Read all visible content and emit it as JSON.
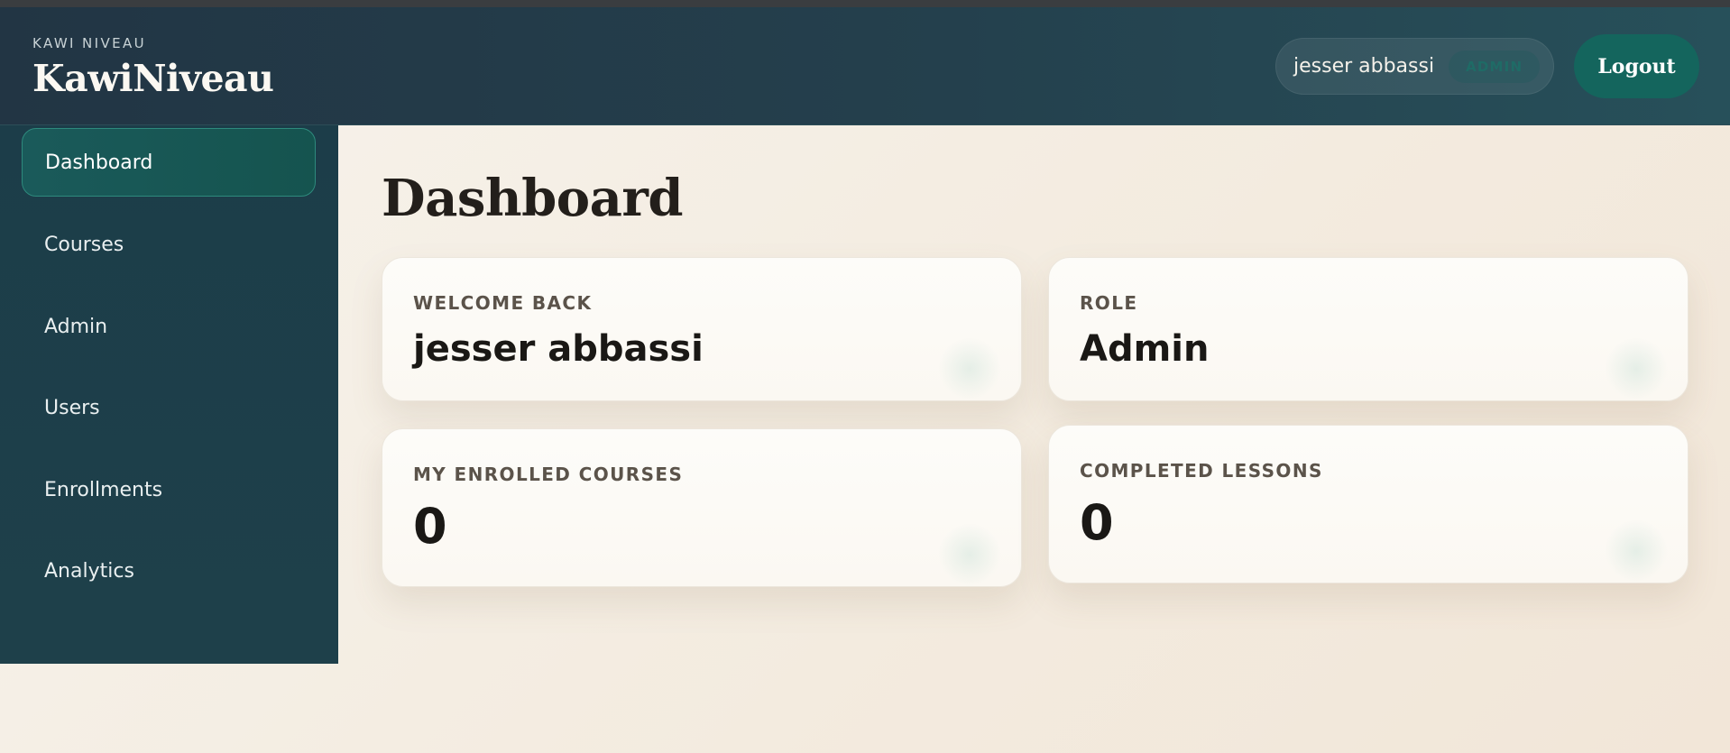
{
  "brand": {
    "kicker": "KAWI NIVEAU",
    "title": "KawiNiveau"
  },
  "user": {
    "name": "jesser abbassi",
    "role_badge": "ADMIN"
  },
  "header": {
    "logout_label": "Logout"
  },
  "sidebar": {
    "items": [
      {
        "label": "Dashboard",
        "active": true
      },
      {
        "label": "Courses",
        "active": false
      },
      {
        "label": "Admin",
        "active": false
      },
      {
        "label": "Users",
        "active": false
      },
      {
        "label": "Enrollments",
        "active": false
      },
      {
        "label": "Analytics",
        "active": false
      }
    ]
  },
  "main": {
    "title": "Dashboard",
    "cards": [
      {
        "label": "WELCOME BACK",
        "value": "jesser abbassi"
      },
      {
        "label": "ROLE",
        "value": "Admin"
      },
      {
        "label": "MY ENROLLED COURSES",
        "value": "0"
      },
      {
        "label": "COMPLETED LESSONS",
        "value": "0"
      }
    ]
  },
  "colors": {
    "header_bg": "#223544",
    "sidebar_bg": "#1c3d49",
    "accent": "#14655d",
    "page_bg": "#f5efe6"
  }
}
